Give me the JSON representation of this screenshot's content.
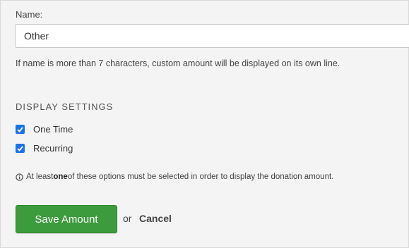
{
  "form": {
    "name_label": "Name:",
    "name_value": "Other",
    "hint": "If name is more than 7 characters, custom amount will be displayed on its own line."
  },
  "display_settings": {
    "title": "DISPLAY SETTINGS",
    "options": [
      {
        "label": "One Time",
        "checked": true
      },
      {
        "label": "Recurring",
        "checked": true
      }
    ],
    "info_before": "At least ",
    "info_bold": "one",
    "info_after": " of these options must be selected in order to display the donation amount.",
    "info_icon": "info-circle-icon"
  },
  "actions": {
    "save_label": "Save Amount",
    "or_text": "or",
    "cancel_label": "Cancel"
  },
  "colors": {
    "save_button": "#3c9b3c",
    "checkbox": "#1a73e8"
  }
}
